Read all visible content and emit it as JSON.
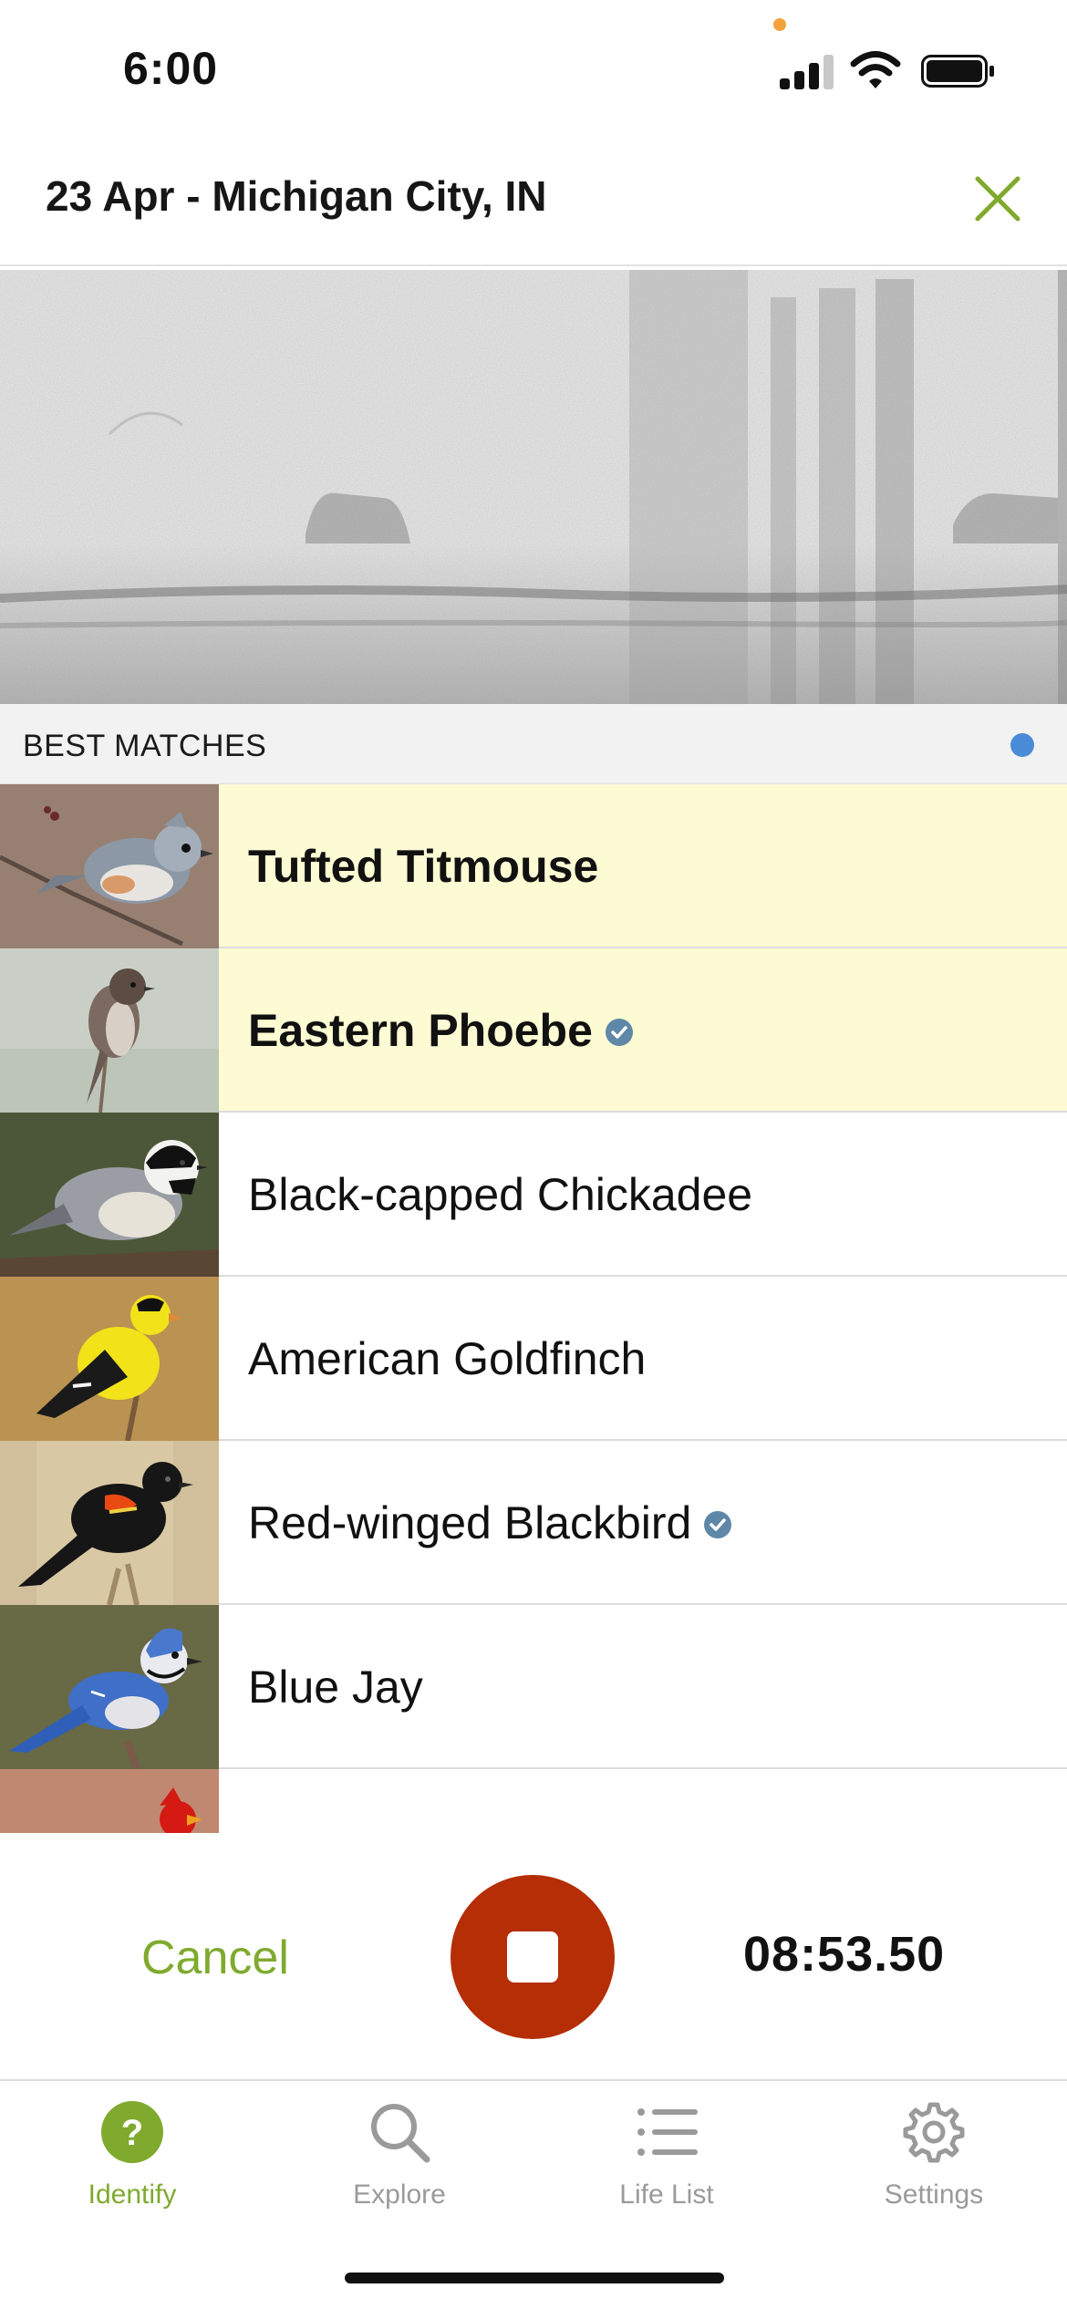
{
  "status_bar": {
    "time": "6:00"
  },
  "header": {
    "title": "23 Apr - Michigan City, IN"
  },
  "section": {
    "title": "BEST MATCHES"
  },
  "matches": [
    {
      "name": "Tufted Titmouse",
      "highlighted": true,
      "verified": false
    },
    {
      "name": "Eastern Phoebe",
      "highlighted": true,
      "verified": true
    },
    {
      "name": "Black-capped Chickadee",
      "highlighted": false,
      "verified": false
    },
    {
      "name": "American Goldfinch",
      "highlighted": false,
      "verified": false
    },
    {
      "name": "Red-winged Blackbird",
      "highlighted": false,
      "verified": true
    },
    {
      "name": "Blue Jay",
      "highlighted": false,
      "verified": false
    }
  ],
  "controls": {
    "cancel_label": "Cancel",
    "timer": "08:53.50"
  },
  "tabs": [
    {
      "label": "Identify",
      "icon": "question-circle-icon",
      "active": true
    },
    {
      "label": "Explore",
      "icon": "search-icon",
      "active": false
    },
    {
      "label": "Life List",
      "icon": "list-icon",
      "active": false
    },
    {
      "label": "Settings",
      "icon": "gear-icon",
      "active": false
    }
  ],
  "colors": {
    "accent_green": "#7faa2e",
    "stop_red": "#b52e06",
    "highlight_yellow": "#fdfbd3",
    "live_dot_blue": "#4a8bd8",
    "verified_blue": "#5f87a8"
  }
}
